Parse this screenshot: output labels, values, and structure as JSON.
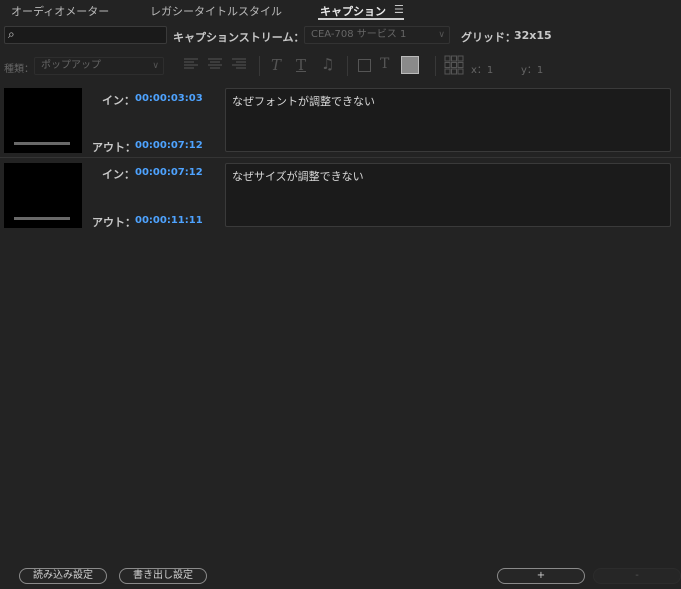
{
  "tabs": [
    {
      "label": "オーディオメーター"
    },
    {
      "label": "レガシータイトルスタイル"
    },
    {
      "label": "キャプション",
      "active": true
    }
  ],
  "tab_menu_icon": "hamburger-menu-icon",
  "search": {
    "value": "",
    "placeholder": ""
  },
  "stream": {
    "label": "キャプションストリーム：",
    "selected": "CEA-708 サービス 1"
  },
  "grid": {
    "label": "グリッド：",
    "value": "32x15"
  },
  "format": {
    "type_label": "種類：",
    "type_selected": "ポップアップ",
    "pos_x": "x：1",
    "pos_y": "y：1",
    "bg_color": "#8a8a8a"
  },
  "captions": [
    {
      "in_label": "イン：",
      "in": "00:00:03:03",
      "out_label": "アウト：",
      "out": "00:00:07:12",
      "text": "なぜフォントが調整できない"
    },
    {
      "in_label": "イン：",
      "in": "00:00:07:12",
      "out_label": "アウト：",
      "out": "00:00:11:11",
      "text": "なぜサイズが調整できない"
    }
  ],
  "footer": {
    "import_label": "読み込み設定",
    "export_label": "書き出し設定",
    "add_label": "+",
    "remove_label": "-"
  },
  "colors": {
    "accent": "#4ea3ff",
    "background": "#232323"
  }
}
